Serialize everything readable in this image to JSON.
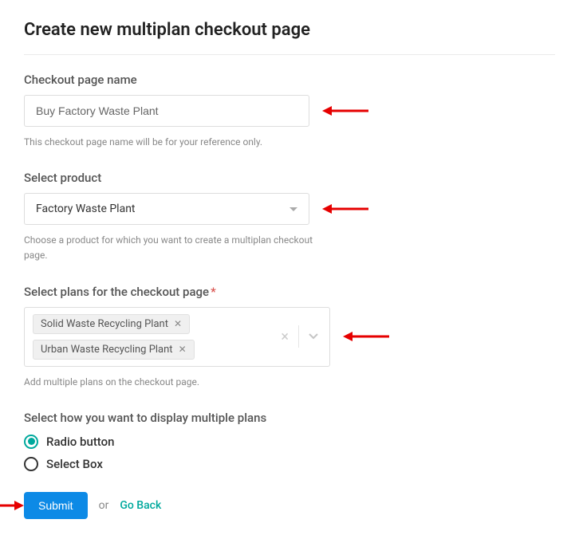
{
  "page_title": "Create new multiplan checkout page",
  "checkout_name": {
    "label": "Checkout page name",
    "value": "Buy Factory Waste Plant",
    "help": "This checkout page name will be for your reference only."
  },
  "product": {
    "label": "Select product",
    "selected": "Factory Waste Plant",
    "help": "Choose a product for which you want to create a multiplan checkout page."
  },
  "plans": {
    "label": "Select plans for the checkout page",
    "required_mark": "*",
    "chips": [
      "Solid Waste Recycling Plant",
      "Urban Waste Recycling Plant"
    ],
    "help": "Add multiple plans on the checkout page."
  },
  "display": {
    "label": "Select how you want to display multiple plans",
    "options": [
      {
        "label": "Radio button",
        "selected": true
      },
      {
        "label": "Select Box",
        "selected": false
      }
    ]
  },
  "actions": {
    "submit": "Submit",
    "or": "or",
    "go_back": "Go Back"
  }
}
